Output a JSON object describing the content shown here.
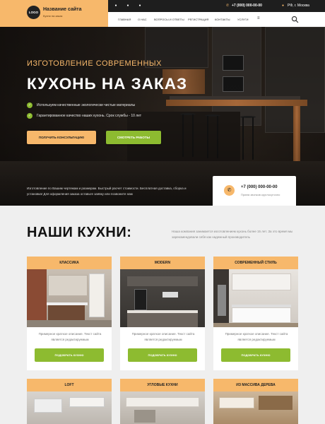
{
  "header": {
    "logo_text": "LOGO",
    "site_name": "Название сайта",
    "tagline": "Кухни на заказ",
    "phone": "+7 (000) 000-00-00",
    "city": "РФ, г. Москва"
  },
  "nav": {
    "items": [
      "Главная",
      "О нас",
      "Вопросы и ответы",
      "Регистрация",
      "Контакты",
      "Услуги"
    ],
    "more": "≡"
  },
  "hero": {
    "subtitle": "ИЗГОТОВЛЕНИЕ СОВРЕМЕННЫХ",
    "title": "КУХОНЬ НА ЗАКАЗ",
    "features": [
      "Используем качественные экологически чистые материалы",
      "Гарантированное качество наших кухонь. Срок службы - 10 лет"
    ],
    "btn_consult": "Получить консультацию",
    "btn_works": "Смотреть работы",
    "description": "Изготовление по Вашим чертежам и размерам. Быстрый расчет стоимости. Бесплатная доставка, сборка и установка! Для оформления заказа оставьте заявку или позвоните нам"
  },
  "contact_card": {
    "phone": "+7 (000) 000-00-00",
    "hint": "Прием звонков круглосуточно"
  },
  "section": {
    "title": "НАШИ КУХНИ:",
    "description": "Наша компания занимается изготовлением кухонь более 15 лет. За это время мы зарекомендовали себя как надежный производитель"
  },
  "cards": [
    {
      "title": "Классика",
      "text": "Примерное краткое описание. Текст сайта является редактируемым",
      "button": "Подобрать кухню"
    },
    {
      "title": "Modern",
      "text": "Примерное краткое описание. Текст сайта является редактируемым",
      "button": "Подобрать кухню"
    },
    {
      "title": "Современный стиль",
      "text": "Примерное краткое описание. Текст сайта является редактируемым",
      "button": "Подобрать кухню"
    },
    {
      "title": "Loft"
    },
    {
      "title": "Угловые кухни"
    },
    {
      "title": "Из массива дерева"
    }
  ],
  "colors": {
    "accent_orange": "#f7b86b",
    "accent_green": "#8dbb30",
    "dark": "#1e1e1e"
  }
}
